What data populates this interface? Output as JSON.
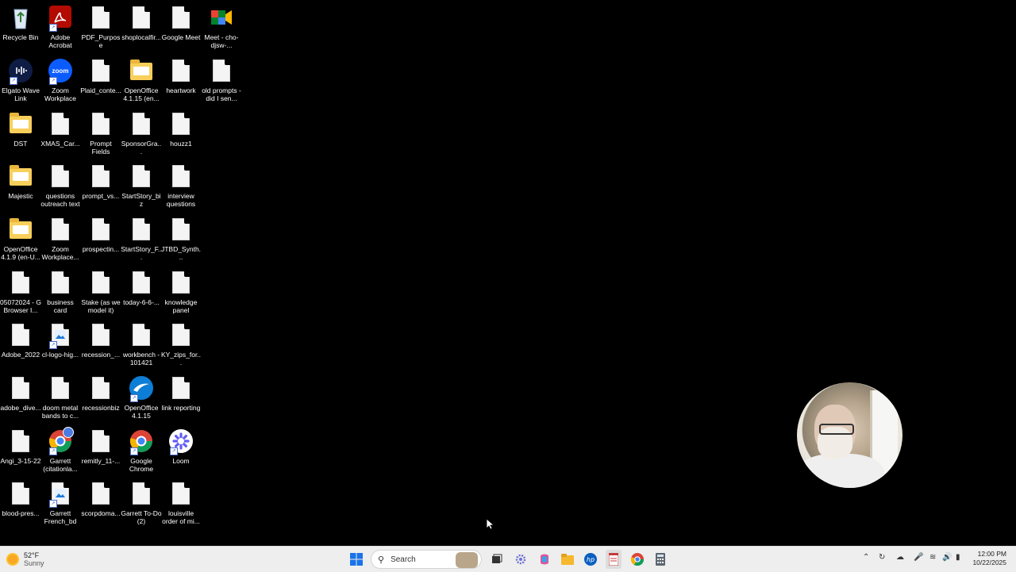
{
  "desktop": {
    "icons": [
      {
        "label": "Recycle Bin",
        "icon": "recycle-bin-icon"
      },
      {
        "label": "Adobe Acrobat",
        "icon": "adobe-acrobat-icon"
      },
      {
        "label": "PDF_Purpose",
        "icon": "document-icon"
      },
      {
        "label": "shoplocalfir...",
        "icon": "document-icon"
      },
      {
        "label": "Google Meet",
        "icon": "document-icon"
      },
      {
        "label": "Meet - cho-djsw-...",
        "icon": "google-meet-icon"
      },
      {
        "label": "Elgato Wave Link",
        "icon": "elgato-wave-link-icon"
      },
      {
        "label": "Zoom Workplace",
        "icon": "zoom-icon"
      },
      {
        "label": "Plaid_conte...",
        "icon": "document-icon"
      },
      {
        "label": "OpenOffice 4.1.15 (en...",
        "icon": "folder-icon"
      },
      {
        "label": "heartwork",
        "icon": "document-icon"
      },
      {
        "label": "old prompts - did I sen...",
        "icon": "document-icon"
      },
      {
        "label": "DST",
        "icon": "folder-icon"
      },
      {
        "label": "XMAS_Car...",
        "icon": "document-icon"
      },
      {
        "label": "Prompt Fields",
        "icon": "document-icon"
      },
      {
        "label": "SponsorGra...",
        "icon": "document-icon"
      },
      {
        "label": "houzz1",
        "icon": "document-icon"
      },
      {
        "label": "Majestic",
        "icon": "folder-icon"
      },
      {
        "label": "questions outreach text",
        "icon": "document-icon"
      },
      {
        "label": "prompt_vs...",
        "icon": "document-icon"
      },
      {
        "label": "StartStory_biz",
        "icon": "document-icon"
      },
      {
        "label": "interview questions",
        "icon": "document-icon"
      },
      {
        "label": "OpenOffice 4.1.9 (en-U...",
        "icon": "folder-icon"
      },
      {
        "label": "Zoom Workplace...",
        "icon": "document-icon"
      },
      {
        "label": "prospectin...",
        "icon": "document-icon"
      },
      {
        "label": "StartStory_F...",
        "icon": "document-icon"
      },
      {
        "label": "JTBD_Synth...",
        "icon": "document-icon"
      },
      {
        "label": "05072024 - G Browser I...",
        "icon": "document-icon"
      },
      {
        "label": "business card",
        "icon": "document-icon"
      },
      {
        "label": "Stake (as we model it)",
        "icon": "document-icon"
      },
      {
        "label": "today-6-6-...",
        "icon": "document-icon"
      },
      {
        "label": "knowledge panel",
        "icon": "document-icon"
      },
      {
        "label": "Adobe_2022",
        "icon": "document-icon"
      },
      {
        "label": "cl-logo-hig...",
        "icon": "image-file-icon"
      },
      {
        "label": "recession_...",
        "icon": "document-icon"
      },
      {
        "label": "workbench - 101421",
        "icon": "document-icon"
      },
      {
        "label": "KY_zips_for...",
        "icon": "document-icon"
      },
      {
        "label": "adobe_dive...",
        "icon": "document-icon"
      },
      {
        "label": "doom metal bands to c...",
        "icon": "document-icon"
      },
      {
        "label": "recessionbiz",
        "icon": "document-icon"
      },
      {
        "label": "OpenOffice 4.1.15",
        "icon": "openoffice-icon"
      },
      {
        "label": "link reporting",
        "icon": "document-icon"
      },
      {
        "label": "Angi_3-15-22",
        "icon": "document-icon"
      },
      {
        "label": "Garrett (citationla...",
        "icon": "chrome-profile-icon"
      },
      {
        "label": "remitly_11-...",
        "icon": "document-icon"
      },
      {
        "label": "Google Chrome",
        "icon": "chrome-icon"
      },
      {
        "label": "Loom",
        "icon": "loom-icon"
      },
      {
        "label": "blood-pres...",
        "icon": "document-icon"
      },
      {
        "label": "Garrett French_bd",
        "icon": "image-file-icon"
      },
      {
        "label": "scorpdoma...",
        "icon": "document-icon"
      },
      {
        "label": "Garrett To-Do (2)",
        "icon": "document-icon"
      },
      {
        "label": "louisville order of mi...",
        "icon": "document-icon"
      }
    ]
  },
  "taskbar": {
    "weather": {
      "temp": "52°F",
      "condition": "Sunny"
    },
    "search_placeholder": "Search",
    "apps": [
      "windows-start-icon",
      "widget-otter-icon",
      "task-view-icon",
      "settings-gear-icon",
      "copilot-icon",
      "file-explorer-icon",
      "hp-icon",
      "notepad-icon",
      "chrome-icon",
      "calculator-icon"
    ],
    "clock": {
      "time": "12:00 PM",
      "date": "10/22/2025"
    }
  }
}
